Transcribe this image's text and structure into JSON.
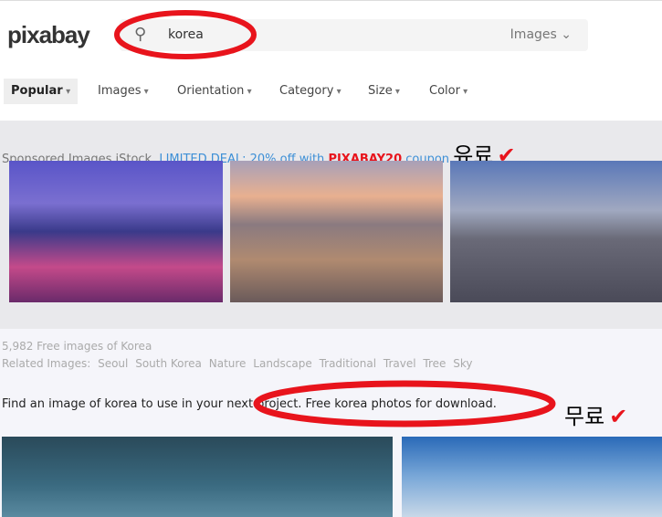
{
  "logo": "pixabay",
  "search": {
    "query": "korea",
    "type": "Images"
  },
  "filters": [
    "Popular",
    "Images",
    "Orientation",
    "Category",
    "Size",
    "Color"
  ],
  "sponsored": {
    "label": "Sponsored Images iStock",
    "deal": "LIMITED DEAL: 20% off with",
    "code": "PIXABAY20",
    "coupon": "coupon"
  },
  "annotations": {
    "paid": "유료",
    "free": "무료",
    "check": "✔"
  },
  "results": {
    "count": "5,982 Free images of Korea",
    "related_label": "Related Images:",
    "related": [
      "Seoul",
      "South Korea",
      "Nature",
      "Landscape",
      "Traditional",
      "Travel",
      "Tree",
      "Sky"
    ],
    "description": "Find an image of korea to use in your next project. Free korea photos for download."
  },
  "colors": {
    "accent": "#3d8fd6",
    "annotation": "#e8141c"
  }
}
